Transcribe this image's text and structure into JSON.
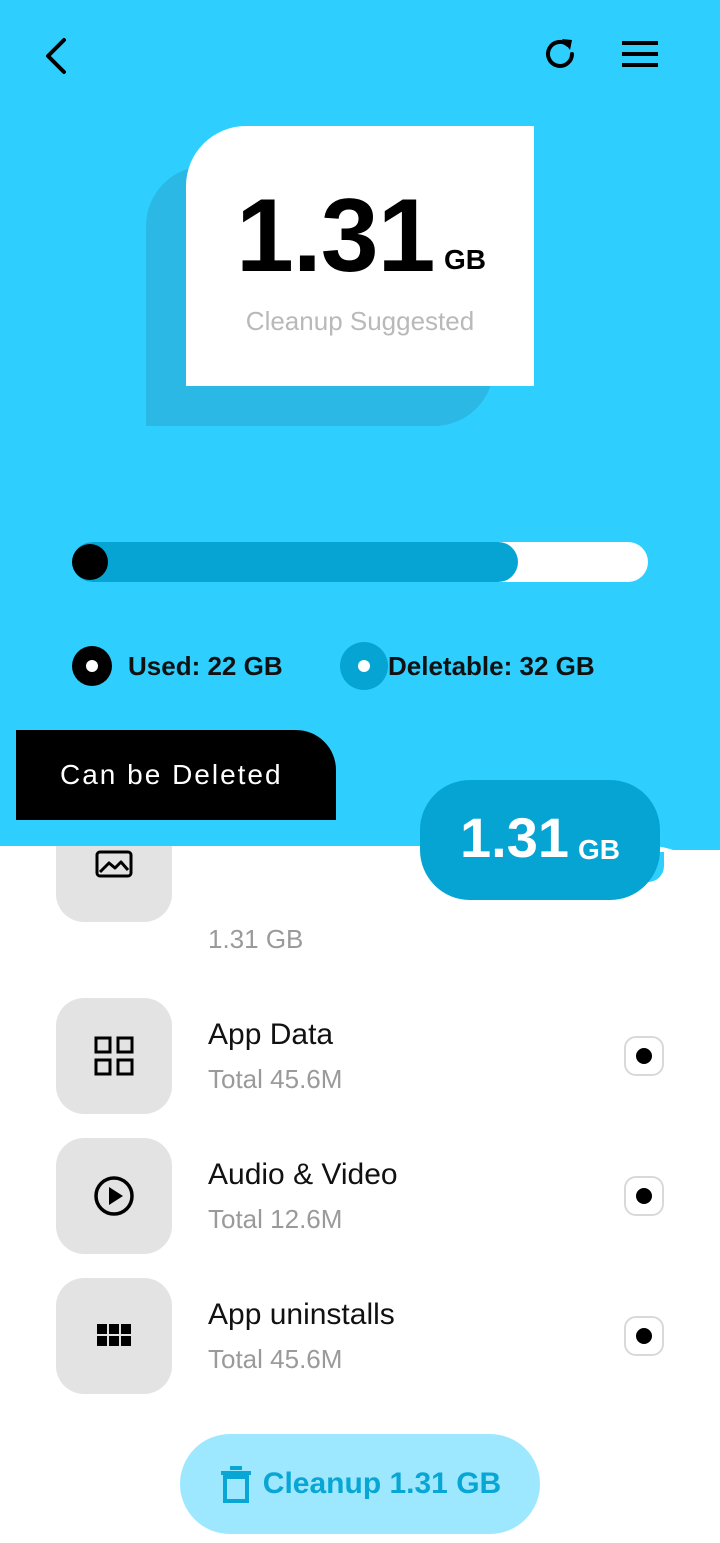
{
  "header": {
    "back_icon": "chevron-left-icon",
    "refresh_icon": "refresh-icon",
    "menu_icon": "hamburger-menu-icon"
  },
  "summary": {
    "size_value": "1.31",
    "size_unit": "GB",
    "caption": "Cleanup Suggested"
  },
  "storage": {
    "used_fraction": 0.775,
    "used_label": "Used: 22 GB",
    "deletable_label": "Deletable: 32 GB",
    "used_color": "#000000",
    "deletable_color": "#05a4d2"
  },
  "section": {
    "tab_label": "Can be Deleted",
    "badge_value": "1.31",
    "badge_unit": "GB"
  },
  "items": [
    {
      "icon": "image-icon",
      "title": "",
      "subtitle": "1.31 GB",
      "selected": true
    },
    {
      "icon": "grid-apps-icon",
      "title": "App Data",
      "subtitle": "Total  45.6M",
      "selected": true
    },
    {
      "icon": "play-circle-icon",
      "title": "Audio & Video",
      "subtitle": "Total  12.6M",
      "selected": true
    },
    {
      "icon": "apps-grid-icon",
      "title": "App uninstalls",
      "subtitle": "Total  45.6M",
      "selected": true
    }
  ],
  "action": {
    "icon": "trash-icon",
    "label": "Cleanup 1.31 GB"
  },
  "colors": {
    "primary_bg": "#2ecfff",
    "accent": "#05a4d2",
    "button_bg": "#9ee8ff"
  }
}
